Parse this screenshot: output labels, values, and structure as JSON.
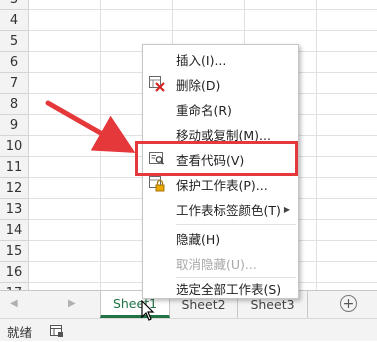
{
  "rows": [
    "3",
    "4",
    "5",
    "6",
    "7",
    "8",
    "9",
    "10",
    "11",
    "12",
    "13",
    "14",
    "15",
    "16",
    "17",
    "18"
  ],
  "sheet_tabs": [
    "Sheet1",
    "Sheet2",
    "Sheet3"
  ],
  "add_sheet_symbol": "+",
  "status": {
    "ready_text": "就绪"
  },
  "context_menu": {
    "insert": "插入(I)...",
    "delete": "删除(D)",
    "rename": "重命名(R)",
    "move_copy": "移动或复制(M)...",
    "view_code": "查看代码(V)",
    "protect_sheet": "保护工作表(P)...",
    "tab_color": "工作表标签颜色(T)",
    "hide": "隐藏(H)",
    "unhide": "取消隐藏(U)...",
    "select_all_sheets": "选定全部工作表(S)"
  },
  "colors": {
    "highlight": "#e5383b",
    "active_tab": "#217346"
  }
}
